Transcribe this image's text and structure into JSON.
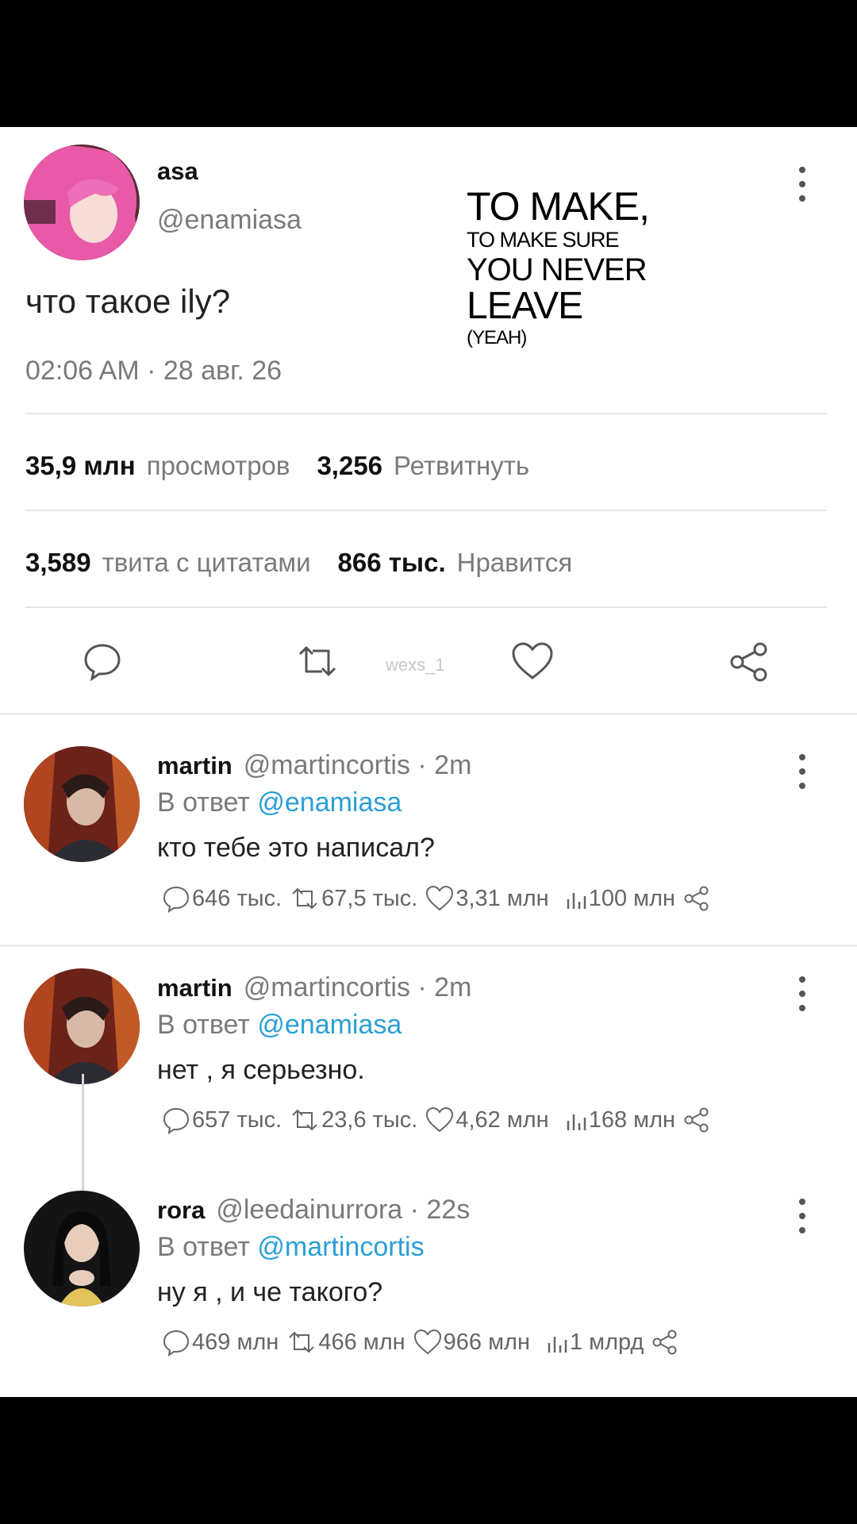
{
  "main_tweet": {
    "display_name": "asa",
    "handle": "@enamiasa",
    "text": "что такое ily?",
    "timestamp": "02:06 AM · 28 авг. 26",
    "overlay_lines": [
      "TO MAKE,",
      "TO MAKE SURE",
      "YOU NEVER",
      "LEAVE",
      "(YEAH)"
    ],
    "stats": {
      "views_value": "35,9 млн",
      "views_label": "просмотров",
      "retweets_value": "3,256",
      "retweets_label": "Ретвитнуть",
      "quotes_value": "3,589",
      "quotes_label": "твита с цитатами",
      "likes_value": "866 тыс.",
      "likes_label": "Нравится"
    },
    "watermark": "wexs_1"
  },
  "replies": [
    {
      "display_name": "martin",
      "handle": "@martincortis · 2m",
      "reply_prefix": "В ответ",
      "reply_mention": "@enamiasa",
      "text": "кто тебе это написал?",
      "metrics": {
        "replies": "646 тыс.",
        "retweets": "67,5 тыс.",
        "likes": "3,31 млн",
        "views": "100 млн"
      }
    },
    {
      "display_name": "martin",
      "handle": "@martincortis · 2m",
      "reply_prefix": "В ответ",
      "reply_mention": "@enamiasa",
      "text": "нет , я серьезно.",
      "metrics": {
        "replies": "657 тыс.",
        "retweets": "23,6 тыс.",
        "likes": "4,62 млн",
        "views": "168 млн"
      }
    },
    {
      "display_name": "rora",
      "handle": "@leedainurrora · 22s",
      "reply_prefix": "В ответ",
      "reply_mention": "@martincortis",
      "text": "ну я , и че такого?",
      "metrics": {
        "replies": "469 млн",
        "retweets": "466 млн",
        "likes": "966 млн",
        "views": "1 млрд"
      }
    }
  ],
  "colors": {
    "mention": "#2a9fd6",
    "secondary_text": "#7a7a7a",
    "background": "#ffffff",
    "letterbox": "#000000"
  },
  "icons": [
    "reply-icon",
    "retweet-icon",
    "like-icon",
    "share-icon",
    "views-icon",
    "more-icon"
  ]
}
